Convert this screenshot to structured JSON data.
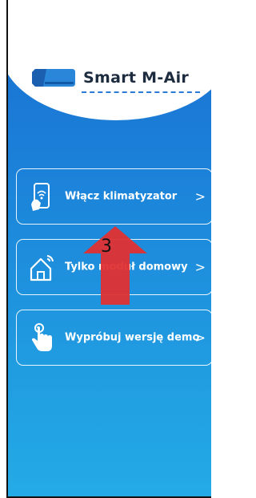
{
  "app": {
    "brand": "Smart M-Air",
    "accent_color": "#1f7fd8"
  },
  "menu": {
    "items": [
      {
        "label": "Włącz klimatyzator",
        "icon": "phone-remote-icon"
      },
      {
        "label": "Tylko moduł domowy",
        "icon": "home-wifi-icon"
      },
      {
        "label": "Wypróbuj wersję demo",
        "icon": "tap-hand-icon"
      }
    ],
    "chevron": ">"
  },
  "annotation": {
    "step_number": "3",
    "arrow_color": "#e03131"
  }
}
